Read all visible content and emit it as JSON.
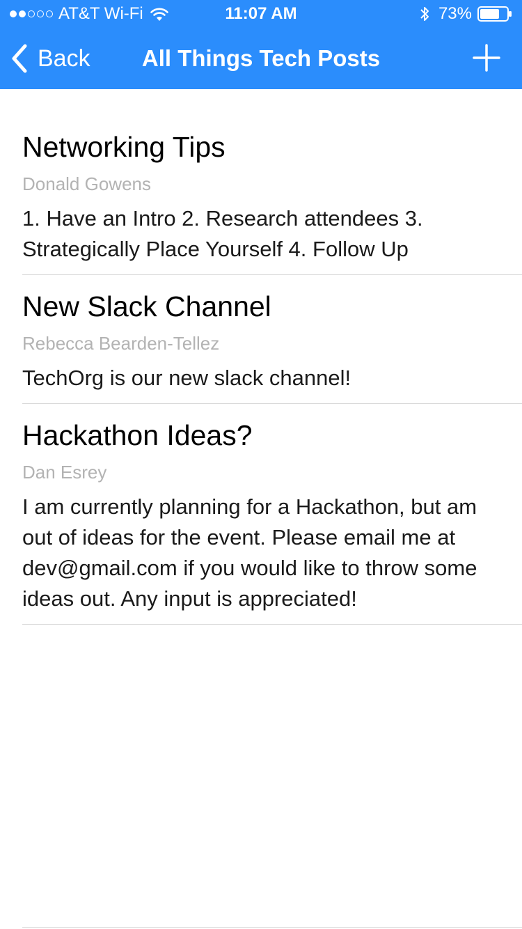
{
  "status_bar": {
    "carrier": "AT&T Wi-Fi",
    "time": "11:07 AM",
    "battery_percent": "73%",
    "signal_bars_filled": 2,
    "signal_bars_total": 5,
    "battery_level": 0.73
  },
  "nav": {
    "back_label": "Back",
    "title": "All Things Tech Posts",
    "add_icon": "plus-icon",
    "back_icon": "chevron-left-icon"
  },
  "posts": [
    {
      "title": "Networking Tips",
      "author": "Donald Gowens",
      "body": "1. Have an Intro 2. Research attendees 3. Strategically Place Yourself 4. Follow Up"
    },
    {
      "title": "New Slack Channel",
      "author": "Rebecca Bearden-Tellez",
      "body": "TechOrg is our new slack channel!"
    },
    {
      "title": "Hackathon Ideas?",
      "author": "Dan Esrey",
      "body": "I am currently planning for a Hackathon, but am out of ideas for the event. Please email me at dev@gmail.com if you would like to throw some ideas out. Any input is appreciated!"
    }
  ],
  "colors": {
    "header_bg": "#2b8dfc",
    "header_text": "#ffffff",
    "author_text": "#b3b3b3",
    "separator": "#d9d9d9"
  }
}
